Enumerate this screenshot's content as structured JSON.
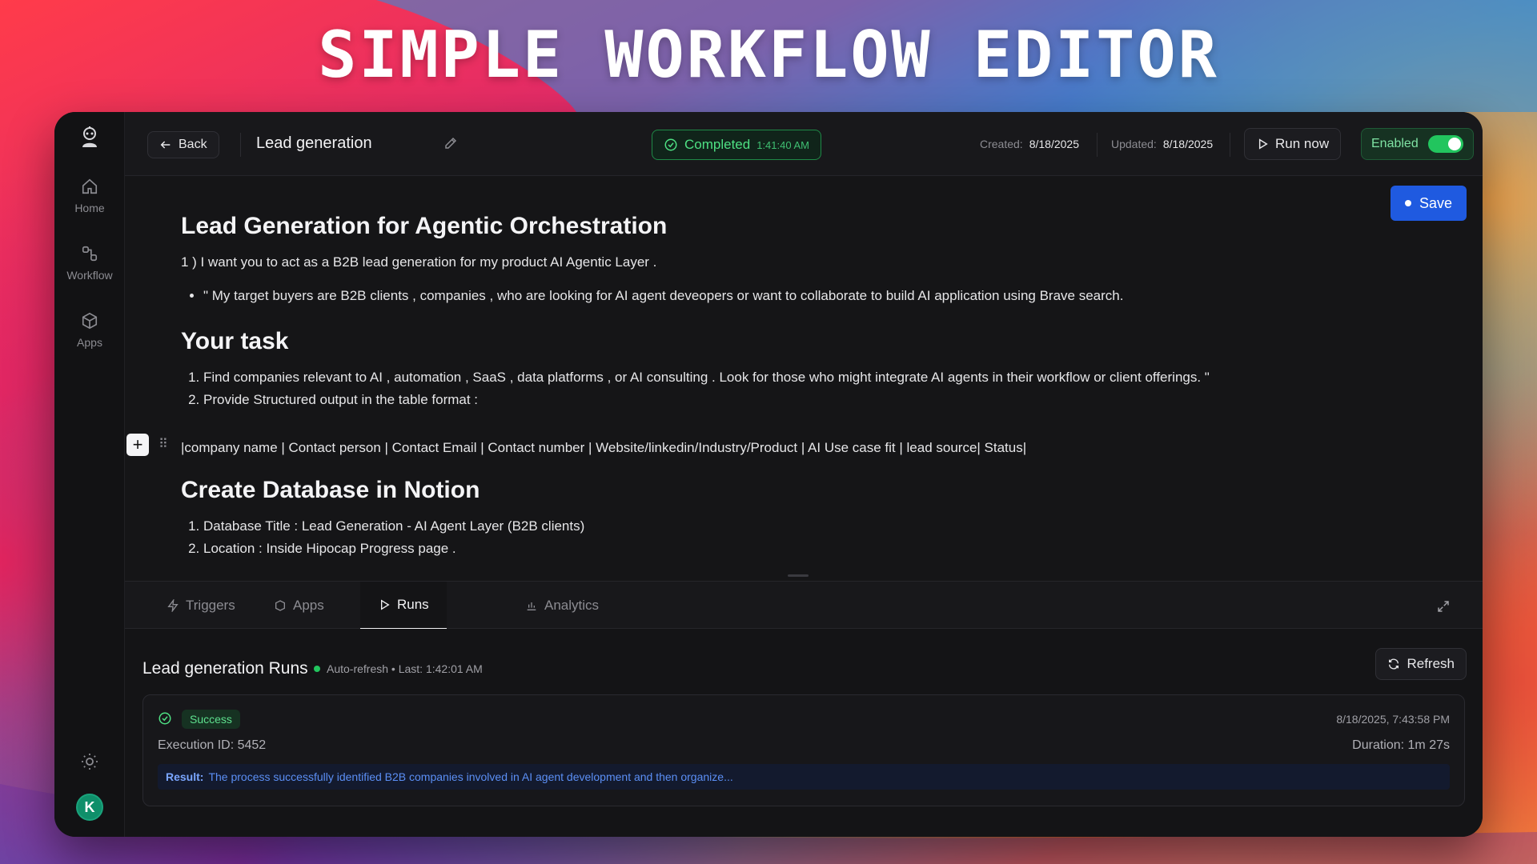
{
  "hero": {
    "title": "SIMPLE WORKFLOW EDITOR"
  },
  "sidebar": {
    "items": [
      {
        "label": "Home",
        "icon": "home-icon"
      },
      {
        "label": "Workflow",
        "icon": "workflow-icon"
      },
      {
        "label": "Apps",
        "icon": "cube-icon"
      }
    ],
    "avatar": "K"
  },
  "topbar": {
    "back_label": "Back",
    "title": "Lead generation",
    "status": "Completed",
    "status_time": "1:41:40 AM",
    "created_label": "Created:",
    "created_value": "8/18/2025",
    "updated_label": "Updated:",
    "updated_value": "8/18/2025",
    "run_label": "Run now",
    "enabled_label": "Enabled"
  },
  "editor": {
    "save_label": "Save",
    "h1": "Lead Generation for Agentic Orchestration",
    "intro": "1 ) I want you to act as a B2B lead generation for my product AI Agentic Layer .",
    "bullet": "\" My target buyers are B2B clients , companies , who are looking for AI agent deveopers or want to collaborate to build AI application using Brave search.",
    "h2": "Your task",
    "task_items": [
      "Find companies  relevant to AI , automation , SaaS , data platforms , or AI consulting .  Look for those who might integrate AI agents in their workflow or client offerings. \"",
      "Provide Structured output in the table format :"
    ],
    "table_row": "|company name | Contact person | Contact Email | Contact number | Website/linkedin/Industry/Product | AI Use case fit | lead source| Status|",
    "h3": "Create Database in Notion",
    "db_items": [
      "Database Title : Lead Generation - AI Agent Layer (B2B clients)",
      "Location : Inside Hipocap Progress page ."
    ]
  },
  "tabs": [
    {
      "label": "Triggers"
    },
    {
      "label": "Apps"
    },
    {
      "label": "Runs"
    },
    {
      "label": "Analytics"
    }
  ],
  "runs": {
    "title": "Lead generation Runs",
    "auto_refresh": "Auto-refresh • Last: 1:42:01 AM",
    "refresh_label": "Refresh",
    "card": {
      "status": "Success",
      "timestamp": "8/18/2025, 7:43:58 PM",
      "execution": "Execution ID: 5452",
      "duration": "Duration: 1m 27s",
      "result_label": "Result:",
      "result_text": "The process successfully identified B2B companies involved in AI agent development and then organize..."
    }
  },
  "colors": {
    "accent": "#1f5ae0",
    "success": "#22c55e"
  }
}
